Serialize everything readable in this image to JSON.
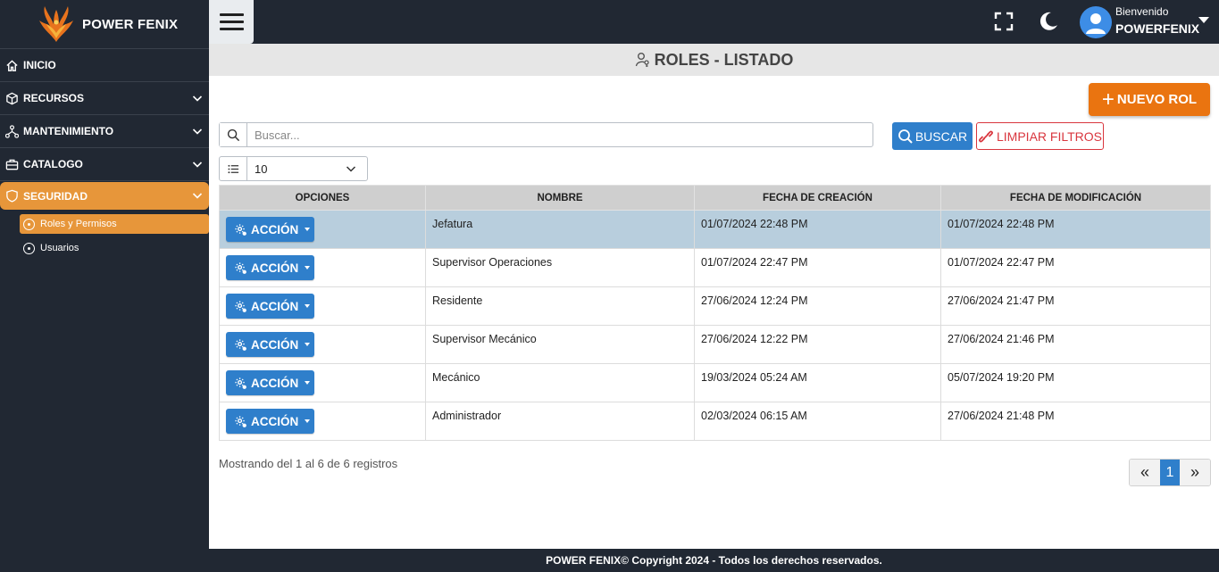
{
  "brand": {
    "name": "POWER FENIX"
  },
  "sidebar": {
    "items": [
      {
        "label": "INICIO",
        "icon": "home-icon"
      },
      {
        "label": "RECURSOS",
        "icon": "cube-icon"
      },
      {
        "label": "MANTENIMIENTO",
        "icon": "network-icon"
      },
      {
        "label": "CATALOGO",
        "icon": "briefcase-icon"
      },
      {
        "label": "SEGURIDAD",
        "icon": "shield-icon",
        "active": true
      }
    ],
    "subitems": [
      {
        "label": "Roles y Permisos",
        "active": true
      },
      {
        "label": "Usuarios"
      }
    ]
  },
  "topbar": {
    "greeting": "Bienvenido",
    "username": "POWERFENIX"
  },
  "page": {
    "title": "ROLES - LISTADO",
    "new_button": "NUEVO ROL",
    "search_placeholder": "Buscar...",
    "search_value": "",
    "search_button": "BUSCAR",
    "clear_button": "LIMPIAR FILTROS",
    "per_page": "10"
  },
  "table": {
    "headers": [
      "OPCIONES",
      "NOMBRE",
      "FECHA DE CREACIÓN",
      "FECHA DE MODIFICACIÓN"
    ],
    "action_label": "ACCIÓN",
    "rows": [
      {
        "nombre": "Jefatura",
        "creacion": "01/07/2024 22:48 PM",
        "modificacion": "01/07/2024 22:48 PM"
      },
      {
        "nombre": "Supervisor Operaciones",
        "creacion": "01/07/2024 22:47 PM",
        "modificacion": "01/07/2024 22:47 PM"
      },
      {
        "nombre": "Residente",
        "creacion": "27/06/2024 12:24 PM",
        "modificacion": "27/06/2024 21:47 PM"
      },
      {
        "nombre": "Supervisor Mecánico",
        "creacion": "27/06/2024 12:22 PM",
        "modificacion": "27/06/2024 21:46 PM"
      },
      {
        "nombre": "Mecánico",
        "creacion": "19/03/2024 05:24 AM",
        "modificacion": "05/07/2024 19:20 PM"
      },
      {
        "nombre": "Administrador",
        "creacion": "02/03/2024 06:15 AM",
        "modificacion": "27/06/2024 21:48 PM"
      }
    ]
  },
  "records_info": "Mostrando del 1 al 6 de 6 registros",
  "pagination": {
    "prev": "«",
    "current": "1",
    "next": "»"
  },
  "footer": {
    "text": "POWER FENIX© Copyright 2024 - Todos los derechos reservados."
  },
  "colors": {
    "sidebar_bg": "#212833",
    "accent_orange": "#e7963a",
    "primary_blue": "#2f7fcb",
    "danger_red": "#d9363e",
    "selected_row": "#b8cedd"
  }
}
